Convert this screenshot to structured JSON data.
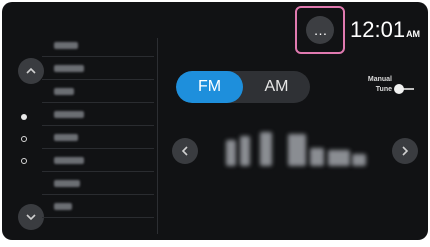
{
  "status": {
    "clock_time": "12:01",
    "clock_ampm": "AM",
    "more_icon": "…"
  },
  "band": {
    "options": [
      "FM",
      "AM"
    ],
    "selected": "FM"
  },
  "manual_tune": {
    "label_line1": "Manual",
    "label_line2": "Tune",
    "on": false
  },
  "presets": {
    "page_count": 3,
    "current_page": 1
  },
  "colors": {
    "accent": "#1e8fdc",
    "highlight": "#e07ab0",
    "background": "#111214"
  }
}
